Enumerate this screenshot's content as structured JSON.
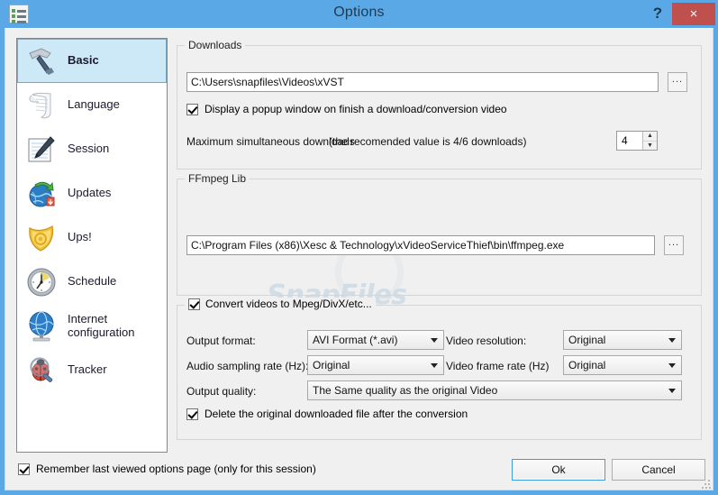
{
  "window": {
    "title": "Options",
    "icon": "options-list-icon",
    "help_label": "?",
    "close_label": "×",
    "titlebar_color": "#5aa9e6",
    "close_color": "#c0504d"
  },
  "watermark": {
    "text": "SnapFiles"
  },
  "sidebar": {
    "items": [
      {
        "label": "Basic",
        "icon": "hammer-icon",
        "selected": true
      },
      {
        "label": "Language",
        "icon": "scroll-icon",
        "selected": false
      },
      {
        "label": "Session",
        "icon": "notepad-pen-icon",
        "selected": false
      },
      {
        "label": "Updates",
        "icon": "globe-refresh-icon",
        "selected": false
      },
      {
        "label": "Ups!",
        "icon": "shield-icon",
        "selected": false
      },
      {
        "label": "Schedule",
        "icon": "clock-icon",
        "selected": false
      },
      {
        "label": "Internet configuration",
        "icon": "globe-network-icon",
        "selected": false
      },
      {
        "label": "Tracker",
        "icon": "bug-magnifier-icon",
        "selected": false
      }
    ]
  },
  "downloads": {
    "group_title": "Downloads",
    "path_value": "C:\\Users\\snapfiles\\Videos\\xVST",
    "browse_label": "...",
    "popup_checkbox": {
      "label": "Display a popup window on finish a download/conversion video",
      "checked": true
    },
    "max_downloads_label": "Maximum simultaneous downloads",
    "max_downloads_hint": "(the recomended value is 4/6 downloads)",
    "max_downloads_value": "4"
  },
  "ffmpeg": {
    "group_title": "FFmpeg Lib",
    "path_value": "C:\\Program Files (x86)\\Xesc & Technology\\xVideoServiceThief\\bin\\ffmpeg.exe",
    "browse_label": "..."
  },
  "convert": {
    "title_checkbox": {
      "label": "Convert videos to Mpeg/DivX/etc...",
      "checked": true
    },
    "output_format_label": "Output format:",
    "output_format_value": "AVI Format (*.avi)",
    "video_resolution_label": "Video resolution:",
    "video_resolution_value": "Original",
    "audio_rate_label": "Audio sampling rate (Hz):",
    "audio_rate_value": "Original",
    "frame_rate_label": "Video frame rate (Hz)",
    "frame_rate_value": "Original",
    "output_quality_label": "Output quality:",
    "output_quality_value": "The Same quality as the original Video",
    "delete_checkbox": {
      "label": "Delete the original downloaded file after the conversion",
      "checked": true
    }
  },
  "footer": {
    "remember_checkbox": {
      "label": "Remember last viewed options page (only for this session)",
      "checked": true
    },
    "ok_label": "Ok",
    "cancel_label": "Cancel"
  }
}
